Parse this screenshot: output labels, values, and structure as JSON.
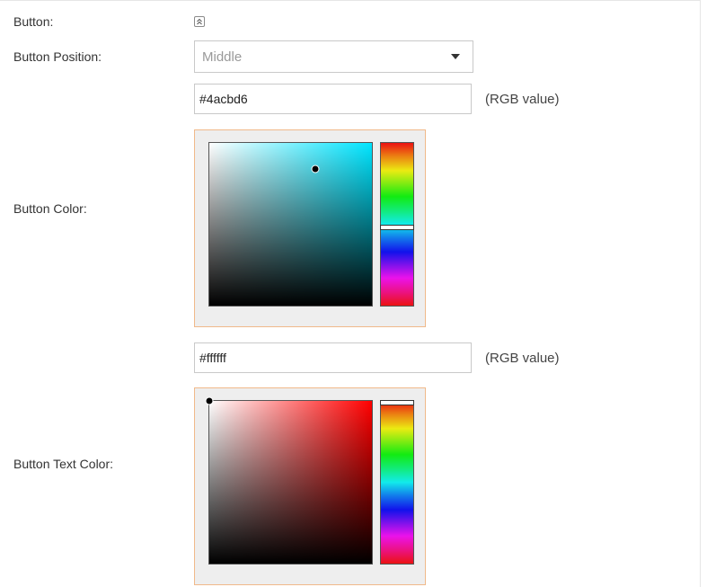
{
  "button_section": {
    "label": "Button:",
    "collapse_icon": "chevron-up-double-icon"
  },
  "button_position": {
    "label": "Button Position:",
    "selected": "Middle",
    "dropdown_icon": "caret-down-icon"
  },
  "button_color": {
    "label": "Button Color:",
    "value": "#4acbd6",
    "unit_label": "(RGB value)",
    "hue_color": "#00e5ff",
    "saturation": 0.65,
    "brightness": 0.84,
    "hue_fraction": 0.51
  },
  "button_text_color": {
    "label": "Button Text Color:",
    "value": "#ffffff",
    "unit_label": "(RGB value)",
    "hue_color": "#ff0000",
    "saturation": 0.0,
    "brightness": 1.0,
    "hue_fraction": 0.0
  }
}
